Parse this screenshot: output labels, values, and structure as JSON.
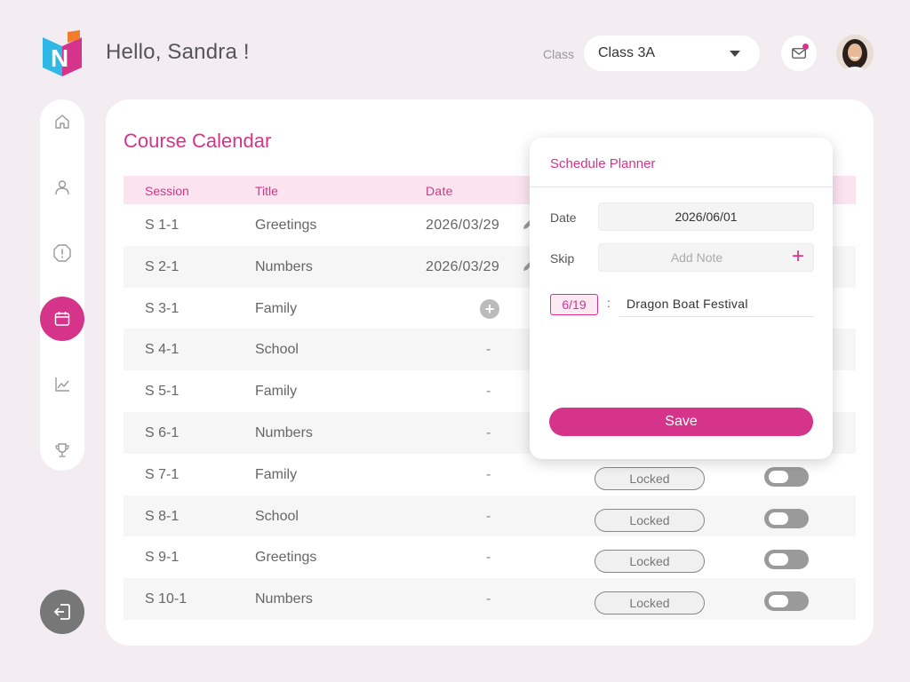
{
  "header": {
    "greeting": "Hello, Sandra !",
    "class_label": "Class",
    "class_selected": "Class 3A"
  },
  "sidebar": {
    "items": [
      {
        "icon": "home-icon"
      },
      {
        "icon": "user-icon"
      },
      {
        "icon": "alert-icon"
      },
      {
        "icon": "calendar-icon",
        "active": true
      },
      {
        "icon": "chart-icon"
      },
      {
        "icon": "trophy-icon"
      }
    ],
    "logout_icon": "logout-icon"
  },
  "calendar": {
    "title": "Course Calendar",
    "columns": [
      "Session",
      "Title",
      "Date"
    ],
    "rows": [
      {
        "session": "S 1-1",
        "title": "Greetings",
        "date": "2026/03/29"
      },
      {
        "session": "S 2-1",
        "title": "Numbers",
        "date": "2026/03/29"
      },
      {
        "session": "S 3-1",
        "title": "Family",
        "date": ""
      },
      {
        "session": "S 4-1",
        "title": "School",
        "date": "-"
      },
      {
        "session": "S 5-1",
        "title": "Family",
        "date": "-"
      },
      {
        "session": "S 6-1",
        "title": "Numbers",
        "date": "-"
      },
      {
        "session": "S 7-1",
        "title": "Family",
        "date": "-",
        "status": "Locked"
      },
      {
        "session": "S 8-1",
        "title": "School",
        "date": "-",
        "status": "Locked"
      },
      {
        "session": "S 9-1",
        "title": "Greetings",
        "date": "-",
        "status": "Locked"
      },
      {
        "session": "S 10-1",
        "title": "Numbers",
        "date": "-",
        "status": "Locked"
      }
    ]
  },
  "planner": {
    "title": "Schedule Planner",
    "date_label": "Date",
    "date_value": "2026/06/01",
    "skip_label": "Skip",
    "note_placeholder": "Add Note",
    "skip_date": "6/19",
    "skip_separator": ":",
    "skip_name": "Dragon Boat Festival",
    "save_label": "Save"
  },
  "colors": {
    "accent": "#d6338a",
    "background": "#f3edf1"
  }
}
